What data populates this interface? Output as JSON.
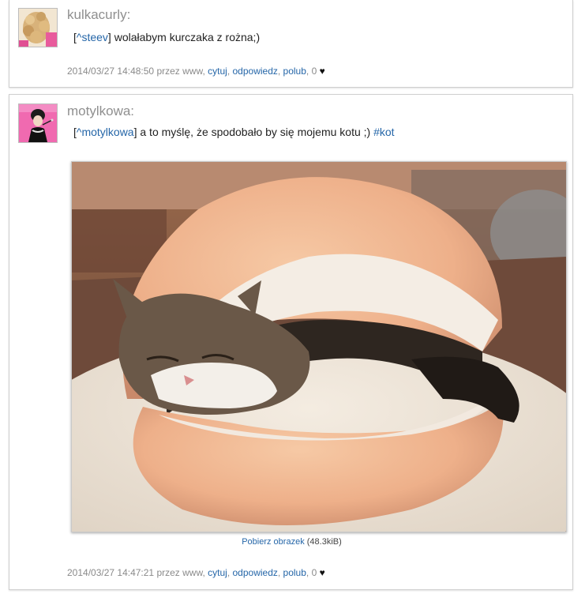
{
  "posts": [
    {
      "username": "kulkacurly:",
      "reply_prefix": "[",
      "reply_link": "^steev",
      "reply_suffix": "]",
      "text": " wolałabym kurczaka z rożna;)",
      "timestamp": "2014/03/27 14:48:50 przez www,",
      "actions": {
        "quote": "cytuj",
        "reply": "odpowiedz",
        "like": "polub"
      },
      "likes": "0",
      "heart": "♥"
    },
    {
      "username": "motylkowa:",
      "reply_prefix": "[",
      "reply_link": "^motylkowa",
      "reply_suffix": "]",
      "text": " a to myślę, że spodobało by się mojemu kotu ;) ",
      "hashtag": "#kot",
      "image_download": "Pobierz obrazek",
      "image_size": "(48.3kiB)",
      "timestamp": "2014/03/27 14:47:21 przez www,",
      "actions": {
        "quote": "cytuj",
        "reply": "odpowiedz",
        "like": "polub"
      },
      "likes": "0",
      "heart": "♥"
    }
  ],
  "colors": {
    "link": "#2566a8",
    "username": "#8f8f8f",
    "meta": "#8a8a8a"
  }
}
